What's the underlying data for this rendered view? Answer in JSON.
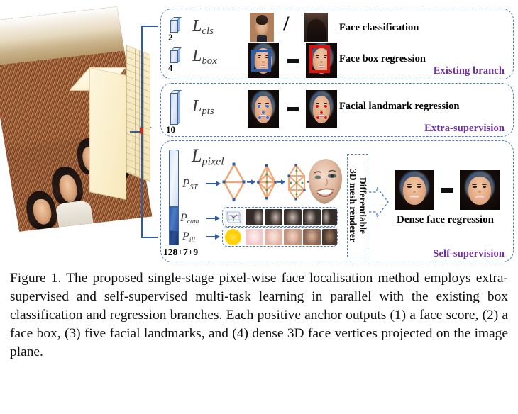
{
  "figure": {
    "input": {
      "image_alt": "crowd-photo",
      "arrow": "arrow-right"
    },
    "feature_map": {
      "label": "feature-pyramid-block",
      "highlight_cell": "positive-anchor"
    },
    "branches": [
      {
        "id": "existing",
        "tag": "Existing branch",
        "rows": [
          {
            "channels": "2",
            "loss_base": "L",
            "loss_sub": "cls",
            "operator": "/",
            "label": "Face classification",
            "left_thumb": "positive-face",
            "right_thumb": "negative-back-of-head"
          },
          {
            "channels": "4",
            "loss_base": "L",
            "loss_sub": "box",
            "operator": "-",
            "label": "Face box regression",
            "left_thumb": "face-with-blue-box",
            "right_thumb": "face-with-red-box"
          }
        ]
      },
      {
        "id": "extra",
        "tag": "Extra-supervision",
        "rows": [
          {
            "channels": "10",
            "loss_base": "L",
            "loss_sub": "pts",
            "operator": "-",
            "label": "Facial landmark regression",
            "left_thumb": "face-with-blue-landmarks",
            "right_thumb": "face-with-red-landmarks"
          }
        ]
      },
      {
        "id": "self",
        "tag": "Self-supervision",
        "channels": "128+7+9",
        "loss_base": "L",
        "loss_sub": "pixel",
        "parameters": [
          {
            "name_base": "P",
            "name_sub": "ST",
            "description": "shape-and-texture-mesh-chain"
          },
          {
            "name_base": "P",
            "name_sub": "cam",
            "description": "camera-parameters"
          },
          {
            "name_base": "P",
            "name_sub": "ill",
            "description": "illumination-parameters"
          }
        ],
        "renderer_label_line1": "Differentiable",
        "renderer_label_line2": "3D mesh renderer",
        "output_label": "Dense face regression",
        "output_operator": "-"
      }
    ],
    "colors": {
      "panel_border": "#4a7ec4",
      "accent_blue": "#2f5ca8",
      "tag_purple": "#7030a0",
      "feature_map": "#f8edcf",
      "box_blue": "#2f5ca8",
      "box_red": "#e20f0f",
      "mesh_orange": "#f0a878",
      "sun_yellow": "#ffd000",
      "anchor_red": "#e02020"
    }
  },
  "caption": {
    "text": "Figure 1. The proposed single-stage pixel-wise face localisation method employs extra-supervised and self-supervised multi-task learning in parallel with the existing box classification and regression branches. Each positive anchor outputs (1) a face score, (2) a face box, (3) five facial landmarks, and (4) dense 3D face vertices projected on the image plane."
  }
}
